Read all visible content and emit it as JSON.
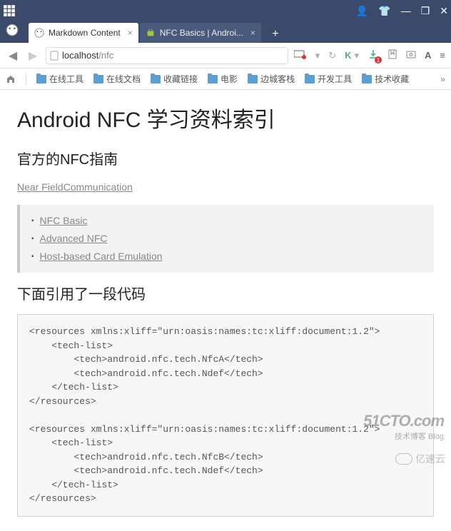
{
  "window": {
    "minimize": "—",
    "maximize": "❐",
    "close": "✕"
  },
  "tabs": {
    "t1": "Markdown Content",
    "t2": "NFC Basics | Androi...",
    "newtab": "+"
  },
  "url": {
    "host": "localhost",
    "path": "/nfc"
  },
  "nav": {
    "letter_k": "K",
    "letter_a": "A",
    "badge": "1"
  },
  "bookmarks": {
    "b1": "在线工具",
    "b2": "在线文档",
    "b3": "收藏链接",
    "b4": "电影",
    "b5": "边城客栈",
    "b6": "开发工具",
    "b7": "技术收藏",
    "more": "»"
  },
  "content": {
    "h1": "Android NFC 学习资料索引",
    "h2a": "官方的NFC指南",
    "link1": "Near FieldCommunication",
    "li1": "NFC Basic",
    "li2": "Advanced NFC",
    "li3": "Host-based Card Emulation",
    "h2b": "下面引用了一段代码",
    "code": "<resources xmlns:xliff=\"urn:oasis:names:tc:xliff:document:1.2\">\n    <tech-list>\n        <tech>android.nfc.tech.NfcA</tech>\n        <tech>android.nfc.tech.Ndef</tech>\n    </tech-list>\n</resources>\n\n<resources xmlns:xliff=\"urn:oasis:names:tc:xliff:document:1.2\">\n    <tech-list>\n        <tech>android.nfc.tech.NfcB</tech>\n        <tech>android.nfc.tech.Ndef</tech>\n    </tech-list>\n</resources>"
  },
  "watermark": {
    "line1": "51CTO.com",
    "line2": "技术博客   Blog",
    "line3": "亿速云"
  }
}
